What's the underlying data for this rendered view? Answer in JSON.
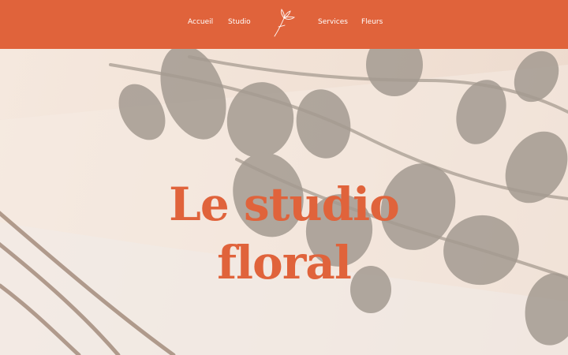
{
  "nav": {
    "left": [
      "Accueil",
      "Studio"
    ],
    "right": [
      "Services",
      "Fleurs"
    ],
    "logo_icon": "flower-line-icon"
  },
  "hero": {
    "title_line1": "Le studio",
    "title_line2": "floral"
  },
  "colors": {
    "accent": "#e0633b",
    "background": "#f3e6dc",
    "shadow": "#9e9488"
  }
}
